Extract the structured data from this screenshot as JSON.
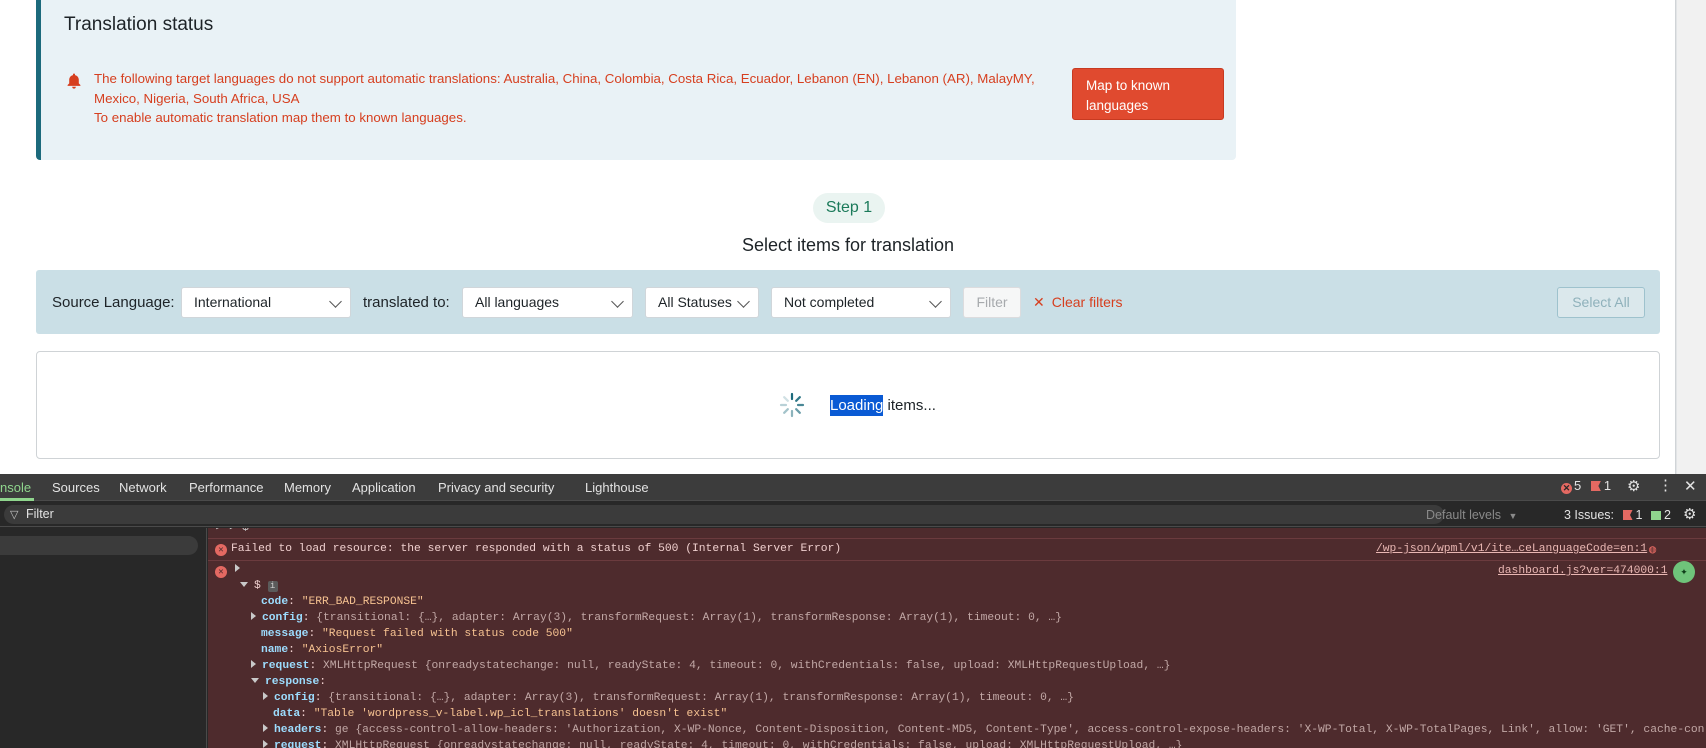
{
  "status": {
    "title": "Translation status",
    "message_line1": "The following target languages do not support automatic translations: Australia, China, Colombia, Costa Rica, Ecuador, Lebanon (EN), Lebanon (AR), MalayMY, Mexico, Nigeria, South Africa, USA",
    "message_line2": "To enable automatic translation map them to known languages.",
    "map_button": "Map to known languages",
    "error_color": "#d63f1f"
  },
  "step": {
    "pill": "Step 1",
    "heading": "Select items for translation"
  },
  "filters": {
    "source_label": "Source Language:",
    "source_value": "International",
    "translated_label": "translated to:",
    "languages_value": "All languages",
    "statuses_value": "All Statuses",
    "completion_value": "Not completed",
    "filter_button": "Filter",
    "clear_button": "Clear filters",
    "select_all_button": "Select All"
  },
  "loading": {
    "highlight": "Loading",
    "rest": " items..."
  },
  "devtools": {
    "tabs": [
      "nsole",
      "Sources",
      "Network",
      "Performance",
      "Memory",
      "Application",
      "Privacy and security",
      "Lighthouse"
    ],
    "error_count": "5",
    "warning_count": "1",
    "filter_placeholder": "Filter",
    "levels": "Default levels",
    "issues_label": "3 Issues:",
    "issues_errors": "1",
    "issues_messages": "2",
    "console": {
      "error1": "Failed to load resource: the server responded with a status of 500 (Internal Server Error)",
      "error1_link": "/wp-json/wpml/v1/ite…ceLanguageCode=en:1",
      "error2_link": "dashboard.js?ver=474000:1",
      "code_value": "\"ERR_BAD_RESPONSE\"",
      "message_value": "\"Request failed with status code 500\"",
      "name_value": "\"AxiosError\"",
      "data_value": "\"Table 'wordpress_v-label.wp_icl_translations' doesn't exist\"",
      "config_preview": "{transitional: {…}, adapter: Array(3), transformRequest: Array(1), transformResponse: Array(1), timeout: 0, …}",
      "request_preview": "XMLHttpRequest {onreadystatechange: null, readyState: 4, timeout: 0, withCredentials: false, upload: XMLHttpRequestUpload, …}",
      "headers_preview": "ge {access-control-allow-headers: 'Authorization, X-WP-Nonce, Content-Disposition, Content-MD5, Content-Type', access-control-expose-headers: 'X-WP-Total, X-WP-TotalPages, Link', allow: 'GET', cache-con"
    }
  }
}
